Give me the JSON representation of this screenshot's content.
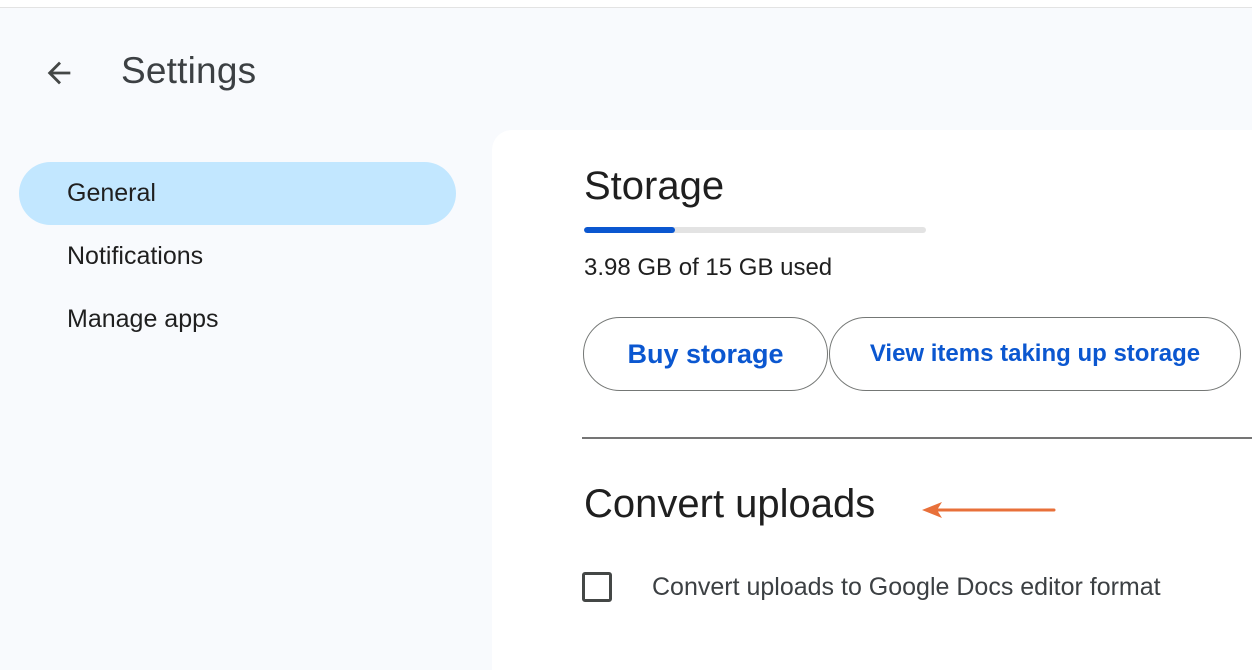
{
  "header": {
    "back_icon": "arrow-left-icon",
    "title": "Settings"
  },
  "sidebar": {
    "items": [
      {
        "label": "General",
        "active": true
      },
      {
        "label": "Notifications",
        "active": false
      },
      {
        "label": "Manage apps",
        "active": false
      }
    ]
  },
  "storage": {
    "title": "Storage",
    "used_fraction": 0.265,
    "usage_text": "3.98 GB of 15 GB used",
    "buy_label": "Buy storage",
    "view_items_label": "View items taking up storage"
  },
  "convert_uploads": {
    "title": "Convert uploads",
    "checkbox_label": "Convert uploads to Google Docs editor format",
    "checked": false
  },
  "colors": {
    "accent": "#0b57d0",
    "active_nav": "#c2e7ff",
    "annotation_arrow": "#e8703a"
  }
}
